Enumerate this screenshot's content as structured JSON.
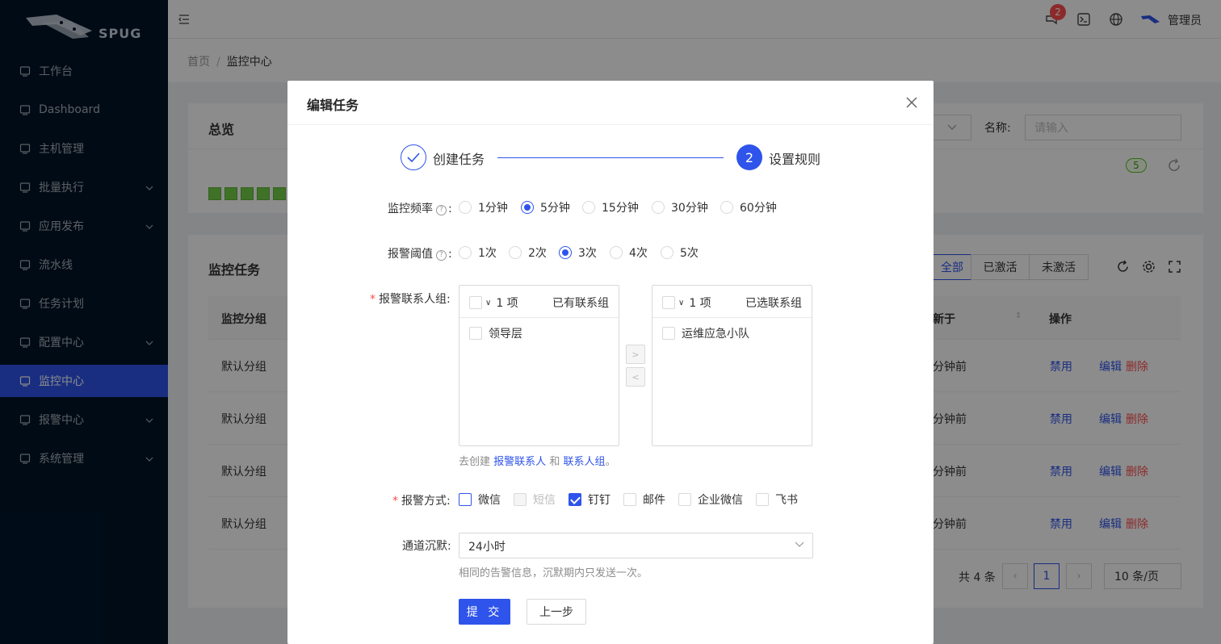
{
  "sidebar": {
    "logo_text": "SPUG",
    "items": [
      {
        "label": "工作台",
        "icon": "desktop-icon",
        "arrow": false,
        "active": false
      },
      {
        "label": "Dashboard",
        "icon": "dashboard-icon",
        "arrow": false,
        "active": false
      },
      {
        "label": "主机管理",
        "icon": "cloud-server-icon",
        "arrow": false,
        "active": false
      },
      {
        "label": "批量执行",
        "icon": "code-icon",
        "arrow": true,
        "active": false
      },
      {
        "label": "应用发布",
        "icon": "flag-icon",
        "arrow": true,
        "active": false
      },
      {
        "label": "流水线",
        "icon": "flag-icon",
        "arrow": false,
        "active": false
      },
      {
        "label": "任务计划",
        "icon": "schedule-icon",
        "arrow": false,
        "active": false
      },
      {
        "label": "配置中心",
        "icon": "deployment-icon",
        "arrow": true,
        "active": false
      },
      {
        "label": "监控中心",
        "icon": "monitor-icon",
        "arrow": false,
        "active": true
      },
      {
        "label": "报警中心",
        "icon": "alert-icon",
        "arrow": true,
        "active": false
      },
      {
        "label": "系统管理",
        "icon": "setting-icon",
        "arrow": true,
        "active": false
      }
    ]
  },
  "header": {
    "notification_count": "2",
    "user_name": "管理员"
  },
  "breadcrumb": {
    "home": "首页",
    "sep": "/",
    "current": "监控中心"
  },
  "overview": {
    "title": "总览",
    "name_label": "名称:",
    "name_placeholder": "请输入",
    "badge": "5"
  },
  "tasks": {
    "title": "监控任务",
    "filters": [
      "全部",
      "已激活",
      "未激活"
    ],
    "columns": [
      "监控分组",
      "新于",
      "操作"
    ],
    "rows": [
      {
        "group": "默认分组",
        "time": "分钟前"
      },
      {
        "group": "默认分组",
        "time": "分钟前"
      },
      {
        "group": "默认分组",
        "time": "分钟前"
      },
      {
        "group": "默认分组",
        "time": "分钟前"
      }
    ],
    "actions": {
      "disable": "禁用",
      "edit": "编辑",
      "delete": "删除"
    },
    "pagination": {
      "total": "共 4 条",
      "page": "1",
      "page_size": "10 条/页"
    }
  },
  "modal": {
    "title": "编辑任务",
    "steps": [
      {
        "label": "创建任务",
        "state": "done"
      },
      {
        "label": "设置规则",
        "number": "2",
        "state": "active"
      }
    ],
    "frequency": {
      "label": "监控频率",
      "options": [
        "1分钟",
        "5分钟",
        "15分钟",
        "30分钟",
        "60分钟"
      ],
      "selected": "5分钟"
    },
    "threshold": {
      "label": "报警阈值",
      "options": [
        "1次",
        "2次",
        "3次",
        "4次",
        "5次"
      ],
      "selected": "3次"
    },
    "contacts": {
      "label": "报警联系人组",
      "left": {
        "count": "1 项",
        "title": "已有联系组",
        "items": [
          "领导层"
        ]
      },
      "right": {
        "count": "1 项",
        "title": "已选联系组",
        "items": [
          "运维应急小队"
        ]
      },
      "hint_prefix": "去创建",
      "hint_link1": "报警联系人",
      "hint_and": "和",
      "hint_link2": "联系人组",
      "hint_suffix": "。"
    },
    "methods": {
      "label": "报警方式",
      "options": [
        {
          "label": "微信",
          "checked": false,
          "disabled": false
        },
        {
          "label": "短信",
          "checked": false,
          "disabled": true
        },
        {
          "label": "钉钉",
          "checked": true,
          "disabled": false
        },
        {
          "label": "邮件",
          "checked": false,
          "disabled": false
        },
        {
          "label": "企业微信",
          "checked": false,
          "disabled": false
        },
        {
          "label": "飞书",
          "checked": false,
          "disabled": false
        }
      ]
    },
    "silence": {
      "label": "通道沉默",
      "value": "24小时",
      "hint": "相同的告警信息，沉默期内只发送一次。"
    },
    "submit_label": "提 交",
    "prev_label": "上一步"
  },
  "colors": {
    "primary": "#2f54eb",
    "sidebar_bg": "#001529",
    "danger": "#ff4d4f"
  }
}
